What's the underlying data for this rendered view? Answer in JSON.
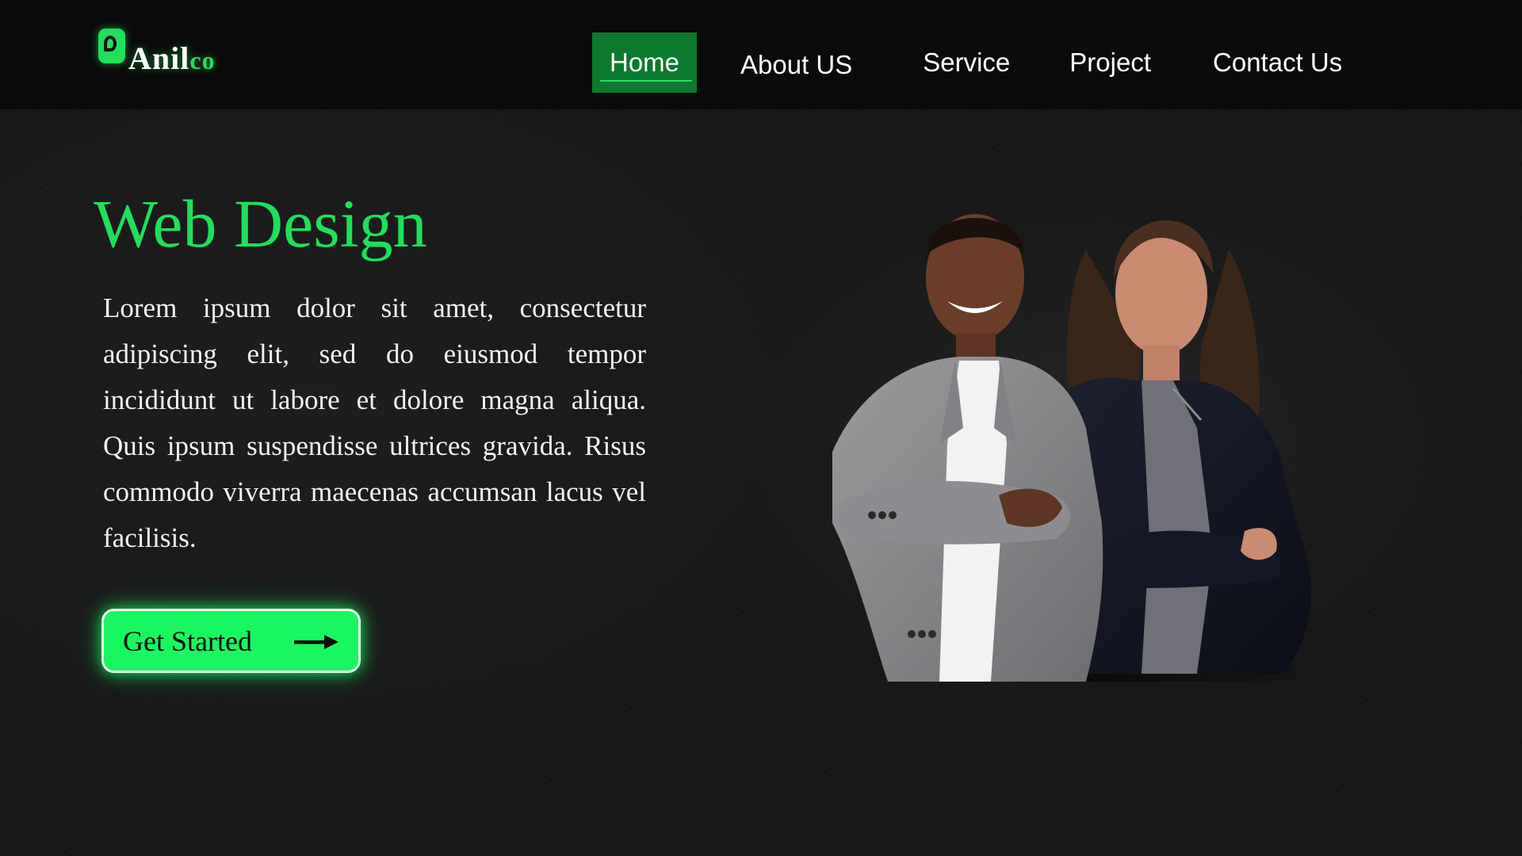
{
  "brand": {
    "name_part1": "Anil",
    "name_part2": "co"
  },
  "nav": {
    "items": [
      {
        "label": "Home",
        "active": true
      },
      {
        "label": "About US",
        "active": false
      },
      {
        "label": "Service",
        "active": false
      },
      {
        "label": "Project",
        "active": false
      },
      {
        "label": "Contact Us",
        "active": false
      }
    ]
  },
  "hero": {
    "title": "Web Design",
    "body": "Lorem ipsum dolor sit amet, consectetur adipiscing elit, sed do eiusmod tempor incididunt ut labore et dolore magna aliqua. Quis ipsum suspendisse ultrices gravida. Risus commodo viverra maecenas accumsan lacus vel facilisis.",
    "cta_label": "Get Started",
    "cta_icon": "arrow-right-icon",
    "image": "two-business-people-photo"
  },
  "colors": {
    "accent": "#1ee05a",
    "button": "#18f760",
    "nav_active_bg": "#0b7a2c",
    "navbar_bg": "#0b0b0b",
    "page_bg": "#181818"
  }
}
